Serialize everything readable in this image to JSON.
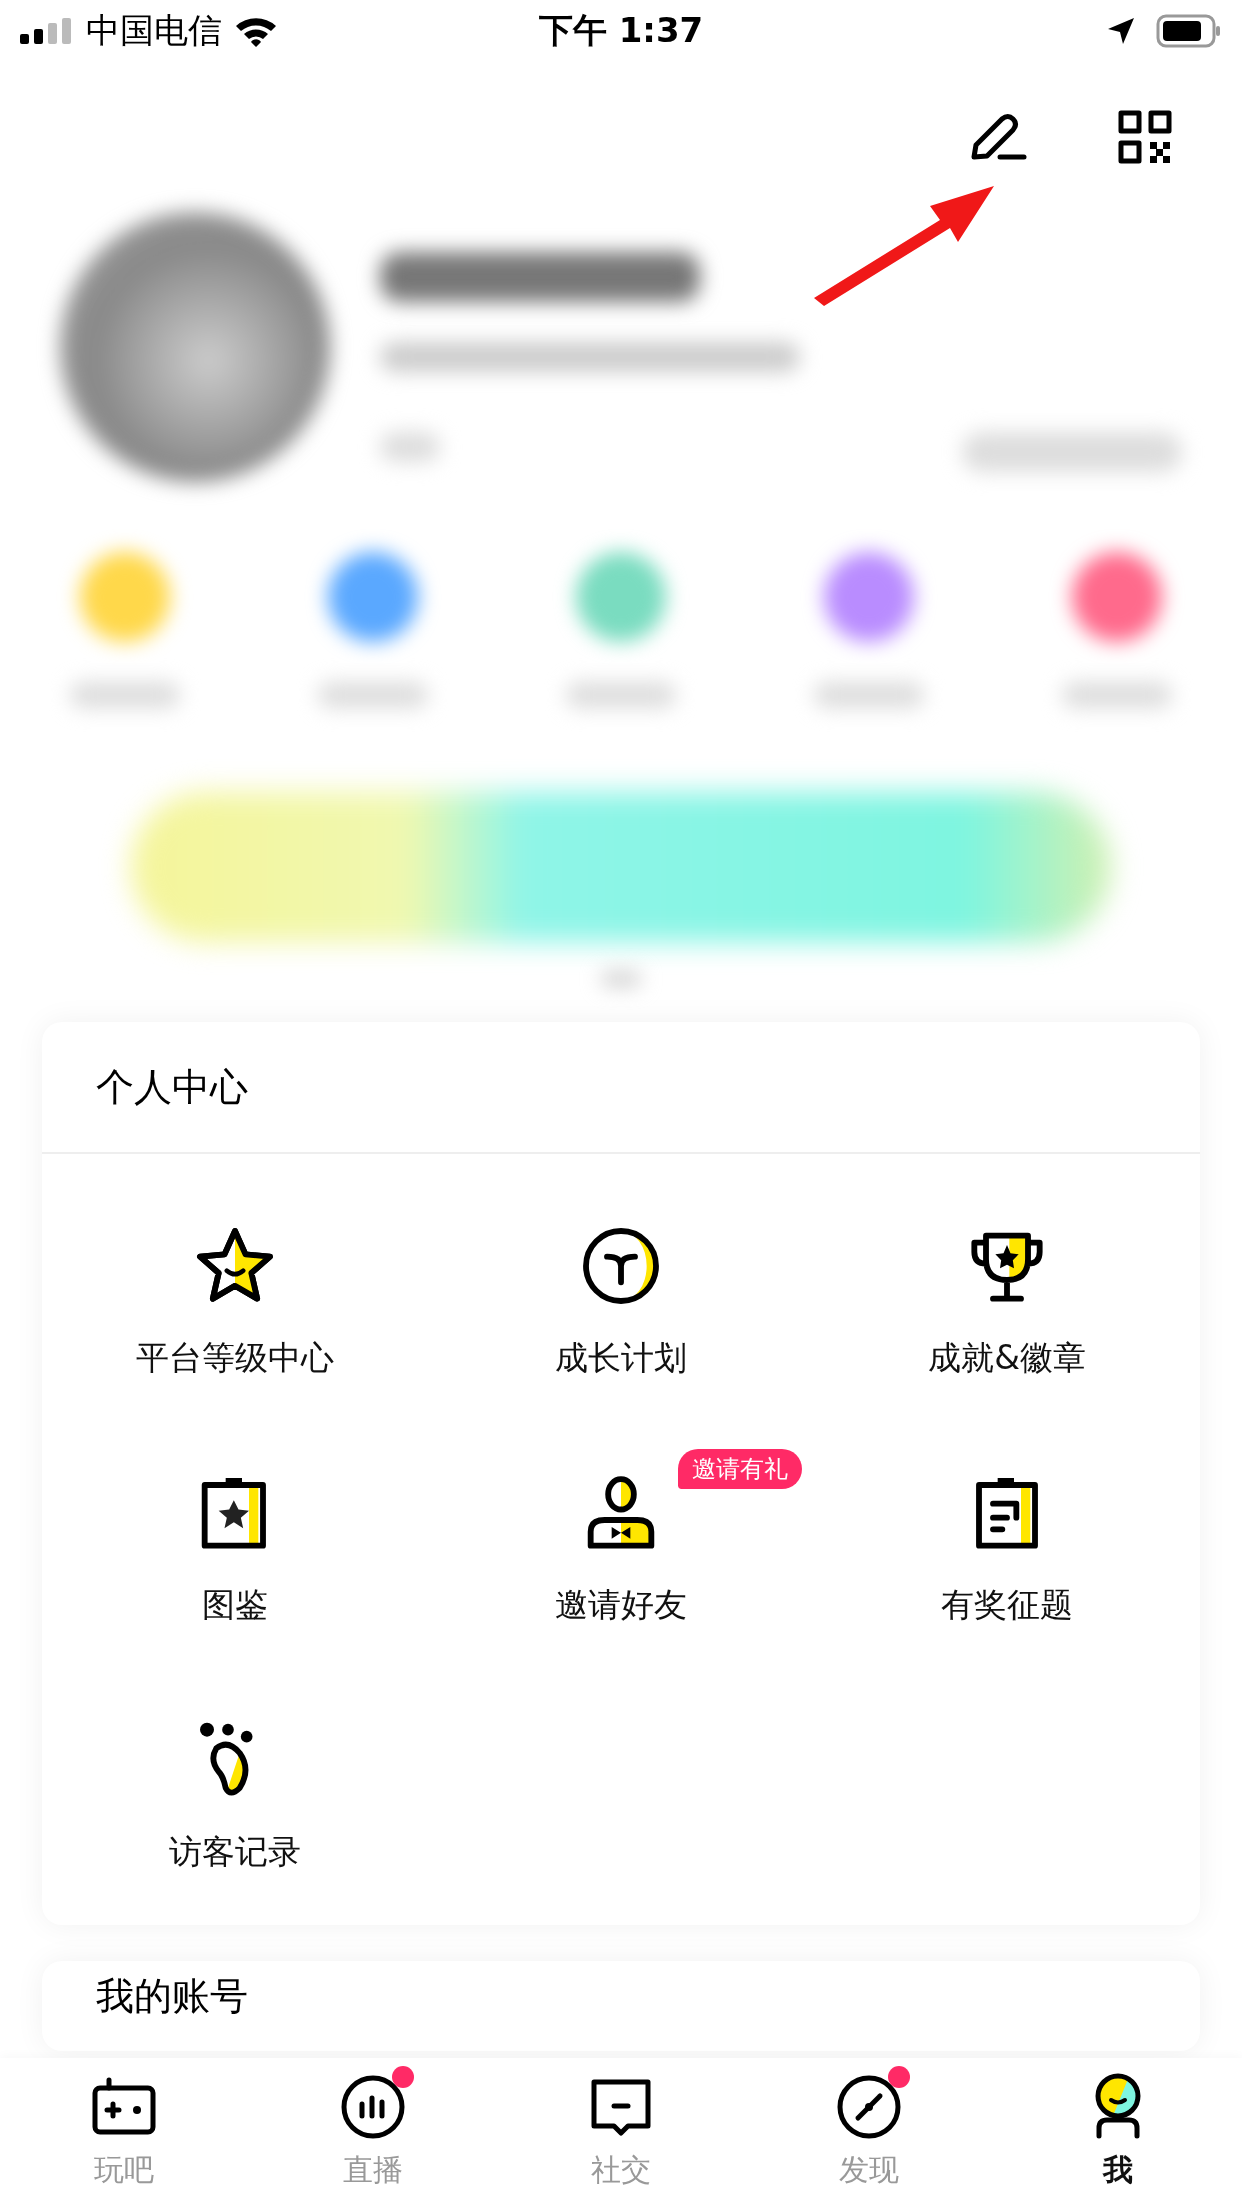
{
  "status_bar": {
    "carrier": "中国电信",
    "time": "下午 1:37"
  },
  "personal_center": {
    "title": "个人中心",
    "items": [
      {
        "kind": "star",
        "label": "平台等级中心"
      },
      {
        "kind": "sprout",
        "label": "成长计划"
      },
      {
        "kind": "trophy",
        "label": "成就&徽章"
      },
      {
        "kind": "album",
        "label": "图鉴"
      },
      {
        "kind": "person",
        "label": "邀请好友",
        "badge": "邀请有礼"
      },
      {
        "kind": "clipboard",
        "label": "有奖征题"
      },
      {
        "kind": "footprint",
        "label": "访客记录"
      }
    ]
  },
  "account": {
    "title": "我的账号"
  },
  "tab_bar": [
    {
      "kind": "game",
      "label": "玩吧",
      "selected": false,
      "dot": false
    },
    {
      "kind": "live",
      "label": "直播",
      "selected": false,
      "dot": true
    },
    {
      "kind": "chat",
      "label": "社交",
      "selected": false,
      "dot": false
    },
    {
      "kind": "compass",
      "label": "发现",
      "selected": false,
      "dot": true
    },
    {
      "kind": "me",
      "label": "我",
      "selected": true,
      "dot": false
    }
  ]
}
